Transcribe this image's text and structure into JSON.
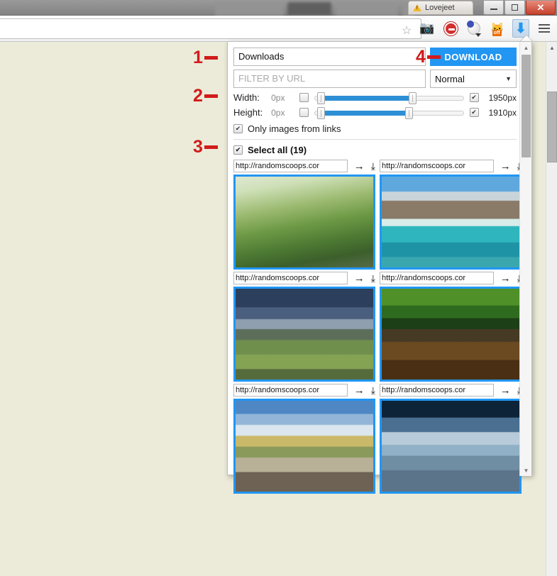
{
  "window": {
    "title": "Lovejeet",
    "warning_icon": "warning-triangle-icon",
    "minimize_label": "",
    "restore_label": "",
    "close_label": "✕"
  },
  "tabs": [
    {
      "label": "",
      "active": false
    },
    {
      "label": "",
      "active": true
    },
    {
      "label": "",
      "active": false
    },
    {
      "label": "",
      "active": false
    }
  ],
  "omnibox": {
    "value": "",
    "bookmark_icon": "star-icon"
  },
  "toolbar_icons": [
    {
      "name": "camera-icon",
      "glyph": "📷"
    },
    {
      "name": "adblock-icon",
      "glyph": ""
    },
    {
      "name": "privacy-badger-icon",
      "glyph": ""
    },
    {
      "name": "ghostery-cat-icon",
      "glyph": "🐱",
      "badge": "off"
    },
    {
      "name": "image-downloader-extension-icon",
      "glyph": "⬇",
      "active": true
    },
    {
      "name": "chrome-menu-icon",
      "glyph": ""
    }
  ],
  "popup": {
    "folder_name": {
      "value": "Downloads",
      "placeholder": "Downloads"
    },
    "download_button_label": "DOWNLOAD",
    "filter_input": {
      "value": "",
      "placeholder": "FILTER BY URL"
    },
    "mode_select": {
      "value": "Normal",
      "options": [
        "Normal"
      ],
      "caret": "▼"
    },
    "width_filter": {
      "label": "Width:",
      "min_value": "0px",
      "min_enabled": false,
      "max_value": "1950px",
      "max_enabled": true,
      "fill_start_pct": 5,
      "fill_end_pct": 65
    },
    "height_filter": {
      "label": "Height:",
      "min_value": "0px",
      "min_enabled": false,
      "max_value": "1910px",
      "max_enabled": true,
      "fill_start_pct": 5,
      "fill_end_pct": 63
    },
    "only_images_from_links": {
      "label": "Only images from links",
      "checked": true
    },
    "select_all": {
      "label": "Select all (19)",
      "checked": true
    },
    "image_cells": [
      {
        "url": "http://randomscoops.cor",
        "open_icon": "arrow-right-icon",
        "save_icon": "download-icon",
        "selected": true,
        "alt": "green mountain valley landscape"
      },
      {
        "url": "http://randomscoops.cor",
        "open_icon": "arrow-right-icon",
        "save_icon": "download-icon",
        "selected": true,
        "alt": "turquoise waterfall pool"
      },
      {
        "url": "http://randomscoops.cor",
        "open_icon": "arrow-right-icon",
        "save_icon": "download-icon",
        "selected": true,
        "alt": "mossy rocks at dusk seashore"
      },
      {
        "url": "http://randomscoops.cor",
        "open_icon": "arrow-right-icon",
        "save_icon": "download-icon",
        "selected": true,
        "alt": "stone bridge over forest river"
      },
      {
        "url": "http://randomscoops.cor",
        "open_icon": "arrow-right-icon",
        "save_icon": "download-icon",
        "selected": true,
        "alt": "autumn lake with mist"
      },
      {
        "url": "http://randomscoops.cor",
        "open_icon": "arrow-right-icon",
        "save_icon": "download-icon",
        "selected": true,
        "alt": "cliffs over calm sea"
      }
    ],
    "scrollbar": {
      "up_arrow": "▲",
      "down_arrow": "▼"
    }
  },
  "page_scrollbar": {
    "up_arrow": "▲",
    "down_arrow": "▼"
  },
  "annotations": [
    {
      "number": "1",
      "target": "folder-name-input"
    },
    {
      "number": "2",
      "target": "size-filters"
    },
    {
      "number": "3",
      "target": "select-all-row"
    },
    {
      "number": "4",
      "target": "download-button"
    }
  ],
  "colors": {
    "accent_blue": "#2196F3",
    "slider_blue": "#2d8fd5",
    "annotation_red": "#d11b1b",
    "page_background": "#ecebd9"
  }
}
